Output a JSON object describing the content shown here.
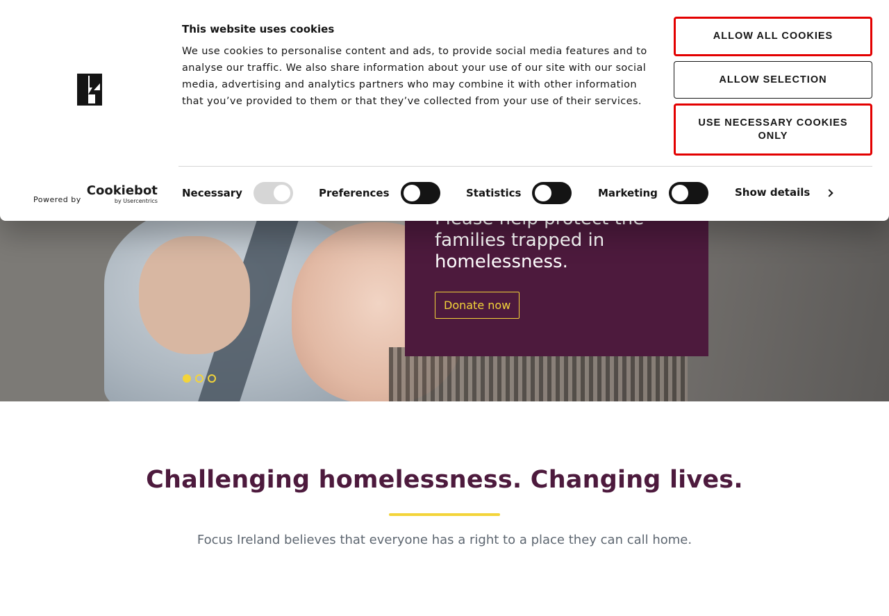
{
  "cookie_banner": {
    "title": "This website uses cookies",
    "body": "We use cookies to personalise content and ads, to provide social media features and to analyse our traffic. We also share information about your use of our site with our social media, advertising and analytics partners who may combine it with other information that you’ve provided to them or that they’ve collected from your use of their services.",
    "buttons": {
      "allow_all": "ALLOW ALL COOKIES",
      "allow_selection": "ALLOW SELECTION",
      "necessary_only": "USE NECESSARY COOKIES ONLY"
    },
    "powered_by": "Powered by",
    "cookiebot": "Cookiebot",
    "cookiebot_sub": "by Usercentrics",
    "toggles": [
      {
        "label": "Necessary",
        "state": "on-disabled"
      },
      {
        "label": "Preferences",
        "state": "off"
      },
      {
        "label": "Statistics",
        "state": "off"
      },
      {
        "label": "Marketing",
        "state": "off"
      }
    ],
    "show_details": "Show details"
  },
  "hero": {
    "headline": "Please help protect the families trapped in homelessness.",
    "cta": "Donate now",
    "slides": 3,
    "active_slide": 1
  },
  "intro": {
    "title": "Challenging homelessness. Changing lives.",
    "subtitle": "Focus Ireland believes that everyone has a right to a place they can call home."
  },
  "colors": {
    "brand_purple": "#4d1a3d",
    "accent_yellow": "#f3d43a",
    "cookie_red": "#e30000"
  },
  "icons": [
    "focus-ireland-logo-icon",
    "chevron-right-icon"
  ]
}
